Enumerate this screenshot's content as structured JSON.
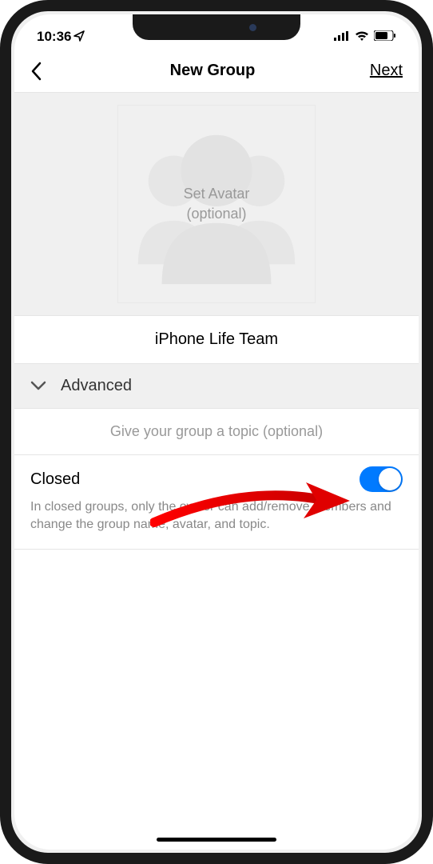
{
  "status": {
    "time": "10:36",
    "location_icon": "➤"
  },
  "nav": {
    "title": "New Group",
    "next": "Next"
  },
  "avatar": {
    "line1": "Set Avatar",
    "line2": "(optional)"
  },
  "group_name": "iPhone Life Team",
  "advanced": {
    "label": "Advanced"
  },
  "topic": {
    "placeholder": "Give your group a topic (optional)"
  },
  "closed": {
    "label": "Closed",
    "description": "In closed groups, only the owner can add/remove members and change the group name, avatar, and topic.",
    "enabled": true
  }
}
